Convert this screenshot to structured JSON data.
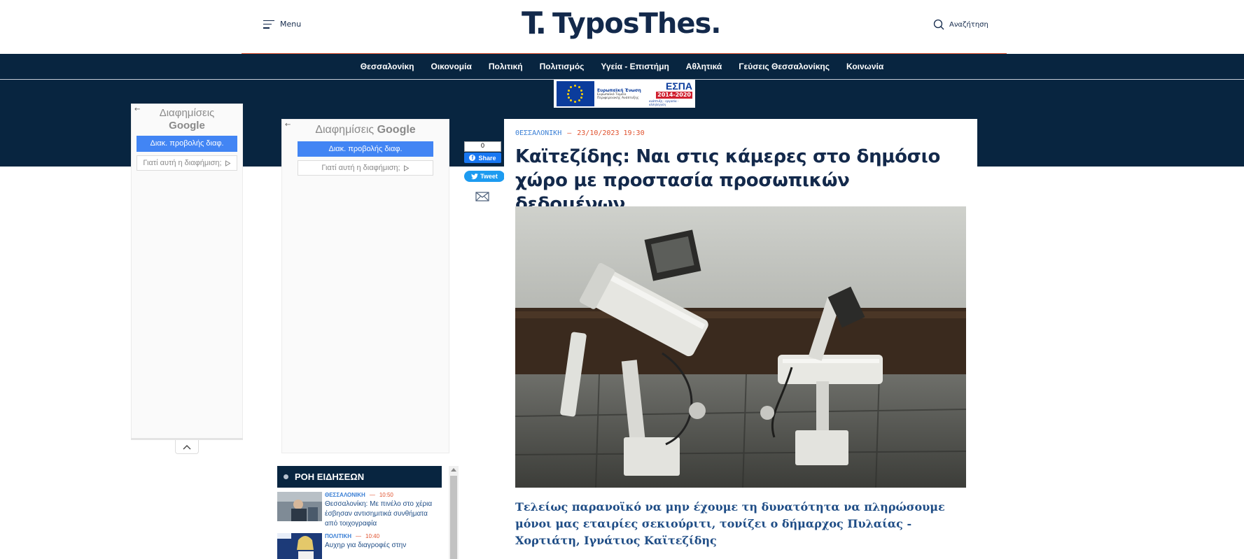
{
  "header": {
    "menu_label": "Menu",
    "logo_mark": "T.",
    "logo_text": "TyposThes.",
    "search_label": "Αναζήτηση"
  },
  "nav": {
    "items": [
      "Θεσσαλονίκη",
      "Οικονομία",
      "Πολιτική",
      "Πολιτισμός",
      "Υγεία - Επιστήμη",
      "Αθλητικά",
      "Γεύσεις Θεσσαλονίκης",
      "Κοινωνία"
    ]
  },
  "banner": {
    "eu_title": "Ευρωπαϊκή Ένωση",
    "eu_sub": "Ευρωπαϊκό Ταμείο Περιφερειακής Ανάπτυξης",
    "espa_title": "ΕΣΠΑ",
    "espa_years": "2014-2020",
    "espa_sub": "ανάπτυξη - εργασία - αλληλεγγύη"
  },
  "ads": {
    "title_prefix": "Διαφημίσεις",
    "title_brand": "Google",
    "button_label": "Διακ. προβολής διαφ.",
    "why_label": "Γιατί αυτή η διαφήμιση;"
  },
  "share": {
    "fb_count": "0",
    "fb_label": "Share",
    "tweet_label": "Tweet"
  },
  "article": {
    "category": "ΘΕΣΣΑΛΟΝΙΚΗ",
    "separator": "—",
    "date": "23/10/2023 19:30",
    "headline": "Καϊτεζίδης: Ναι στις κάμερες στο δημόσιο χώρο με προστασία προσωπικών δεδομένων",
    "lead": "Τελείως παρανοϊκό να μην έχουμε τη δυνατότητα να πληρώσουμε μόνοι μας εταιρίες σεκιούριτι, τονίζει ο δήμαρχος Πυλαίας - Χορτιάτη, Ιγνάτιος Καϊτεζίδης"
  },
  "feed": {
    "title": "ΡΟΗ ΕΙΔΗΣΕΩΝ",
    "items": [
      {
        "category": "ΘΕΣΣΑΛΟΝΙΚΗ",
        "separator": "—",
        "time": "10:50",
        "title": "Θεσσαλονίκη: Με πινέλο στο χέρια έσβησαν αντισημιτικά συνθήματα από τοιχογραφία"
      },
      {
        "category": "ΠΟΛΙΤΙΚΗ",
        "separator": "—",
        "time": "10:40",
        "title": "Αυχηρ για διαγροφές στην"
      }
    ]
  },
  "colors": {
    "navy": "#082540",
    "accent_red": "#e0522e",
    "link_blue": "#3a7fd5",
    "ad_blue": "#4285f4"
  }
}
